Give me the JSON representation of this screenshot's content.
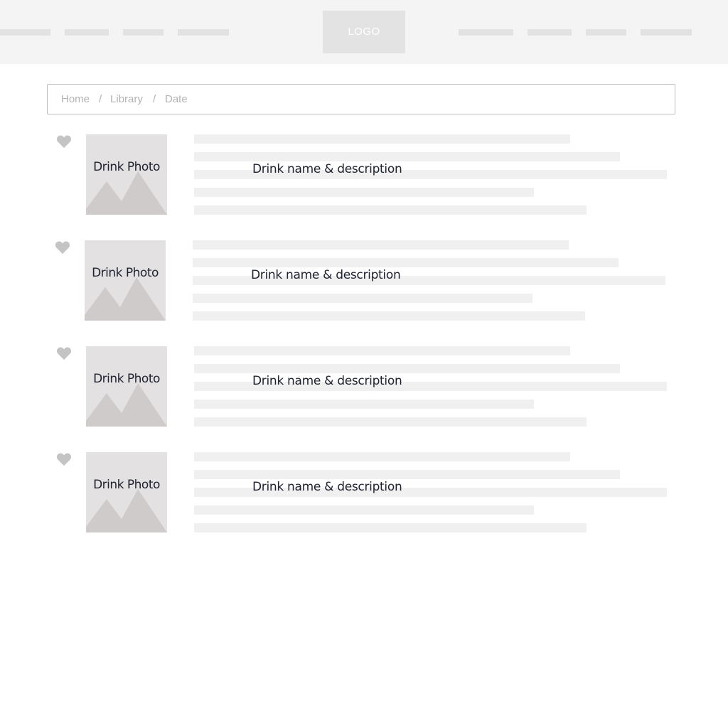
{
  "header": {
    "logo_label": "LOGO"
  },
  "breadcrumb": {
    "items": [
      "Home",
      "Library",
      "Date"
    ],
    "separator": "/"
  },
  "drinks": [
    {
      "photo_label": "Drink Photo",
      "description": "Drink name & description",
      "favorite_icon": "heart-icon"
    },
    {
      "photo_label": "Drink Photo",
      "description": "Drink name & description",
      "favorite_icon": "heart-icon"
    },
    {
      "photo_label": "Drink Photo",
      "description": "Drink name & description",
      "favorite_icon": "heart-icon"
    },
    {
      "photo_label": "Drink Photo",
      "description": "Drink name & description",
      "favorite_icon": "heart-icon"
    }
  ],
  "colors": {
    "nav_background": "#f4f4f4",
    "placeholder_bar": "#e2e2e2",
    "photo_background": "#e3e1e1",
    "mountain": "#cfcbcb",
    "heart": "#c4c4c4",
    "text_dark": "#1e2230",
    "breadcrumb_text": "#b3b3b3"
  }
}
